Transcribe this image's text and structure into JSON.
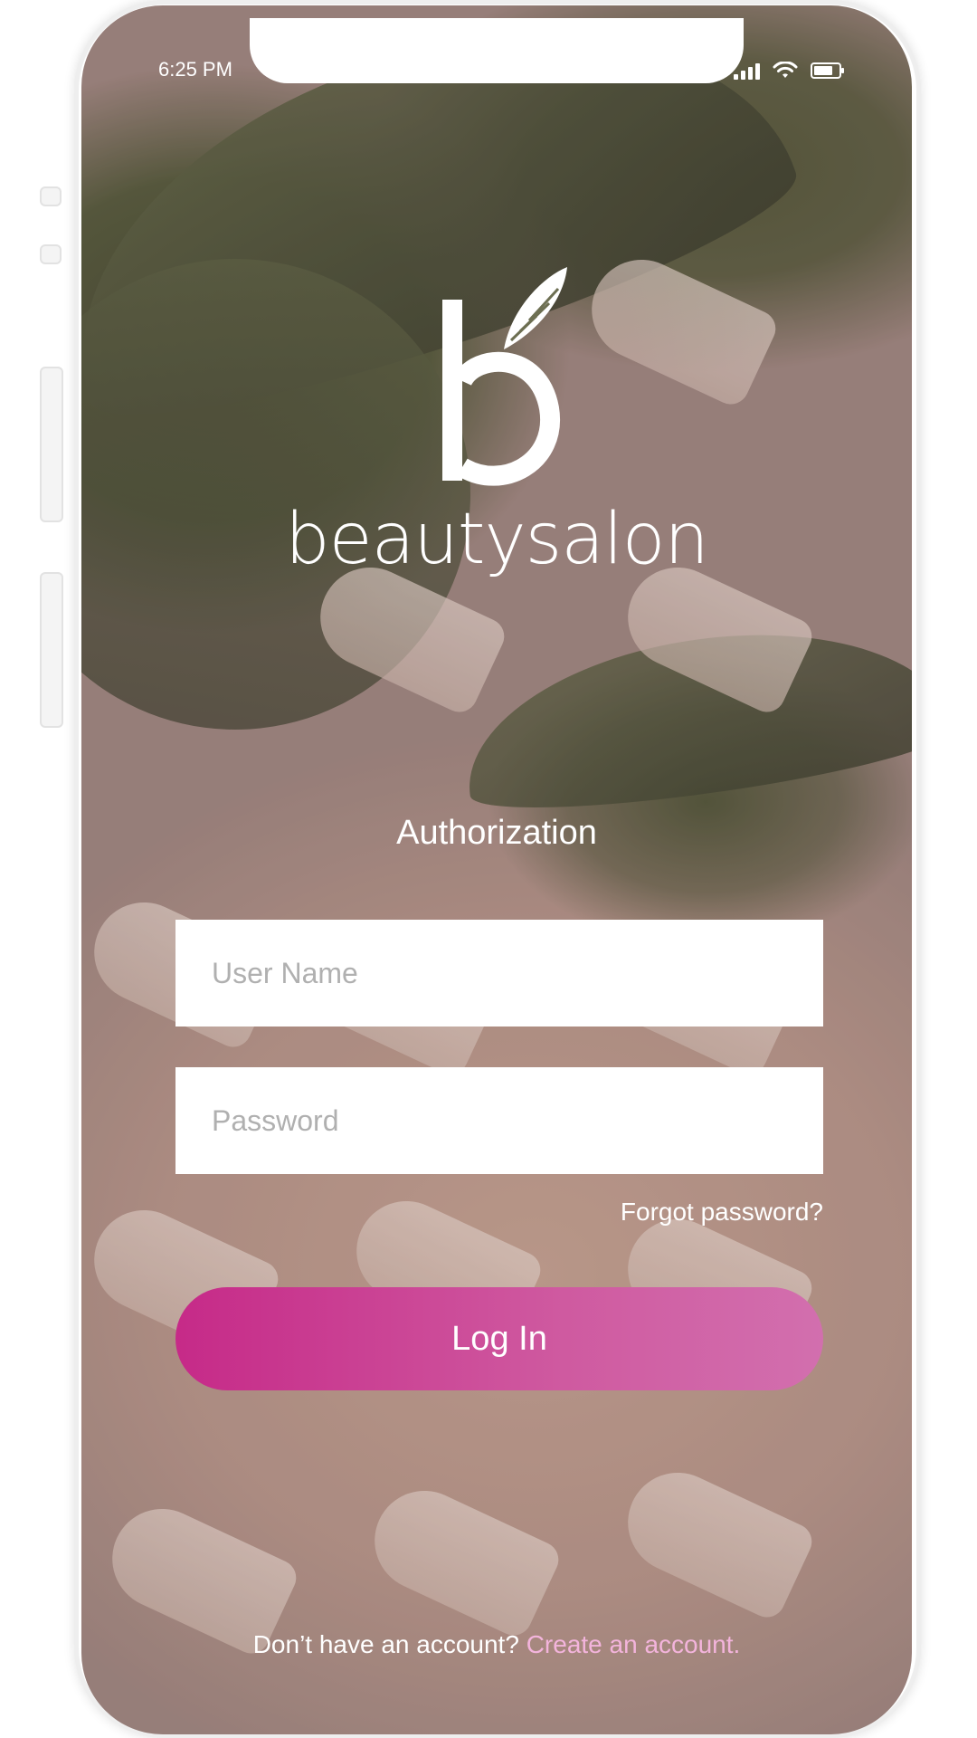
{
  "status_bar": {
    "time": "6:25 PM",
    "icons": [
      "signal-icon",
      "wifi-icon",
      "battery-icon"
    ]
  },
  "branding": {
    "logo_letter": "b",
    "app_name": "beautysalon"
  },
  "auth": {
    "title": "Authorization",
    "username_placeholder": "User Name",
    "password_placeholder": "Password",
    "forgot_label": "Forgot password?",
    "login_label": "Log In"
  },
  "signup": {
    "prompt": "Don’t have an account?",
    "link": "Create an account."
  },
  "colors": {
    "accent_start": "#c62a88",
    "accent_end": "#d26fae",
    "link": "#f3b4dc",
    "text": "#ffffff"
  }
}
